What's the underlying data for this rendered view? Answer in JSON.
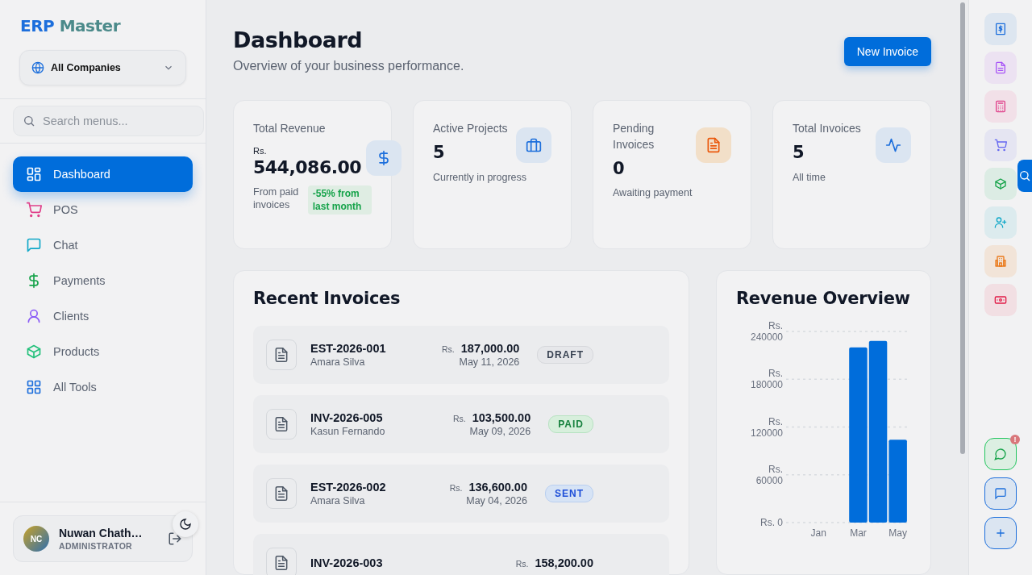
{
  "sidebar": {
    "logo": {
      "first": "ERP",
      "second": "Master"
    },
    "company_select": {
      "value": "All Companies"
    },
    "search": {
      "placeholder": "Search menus..."
    },
    "items": [
      {
        "label": "Dashboard",
        "selected": true
      },
      {
        "label": "POS",
        "selected": false
      },
      {
        "label": "Chat",
        "selected": false
      },
      {
        "label": "Payments",
        "selected": false
      },
      {
        "label": "Clients",
        "selected": false
      },
      {
        "label": "Products",
        "selected": false
      },
      {
        "label": "All Tools",
        "selected": false
      }
    ],
    "user": {
      "initials": "NC",
      "name": "Nuwan Chath…",
      "role": "ADMINISTRATOR"
    }
  },
  "header": {
    "title": "Dashboard",
    "subtitle": "Overview of your business performance.",
    "action": "New Invoice"
  },
  "stats": [
    {
      "title": "Total Revenue",
      "currency": "Rs.",
      "value": "544,086.00",
      "note": "From paid invoices",
      "trend": "-55% from last month"
    },
    {
      "title": "Active Projects",
      "value": "5",
      "note": "Currently in progress"
    },
    {
      "title": "Pending Invoices",
      "value": "0",
      "note": "Awaiting payment"
    },
    {
      "title": "Total Invoices",
      "value": "5",
      "note": "All time"
    }
  ],
  "recent_invoices": {
    "title": "Recent Invoices",
    "rows": [
      {
        "number": "EST-2026-001",
        "client": "Amara Silva",
        "currency": "Rs.",
        "amount": "187,000.00",
        "date": "May 11, 2026",
        "status": {
          "label": "DRAFT",
          "kind": "draft"
        }
      },
      {
        "number": "INV-2026-005",
        "client": "Kasun Fernando",
        "currency": "Rs.",
        "amount": "103,500.00",
        "date": "May 09, 2026",
        "status": {
          "label": "PAID",
          "kind": "paid"
        }
      },
      {
        "number": "EST-2026-002",
        "client": "Amara Silva",
        "currency": "Rs.",
        "amount": "136,600.00",
        "date": "May 04, 2026",
        "status": {
          "label": "SENT",
          "kind": "sent"
        }
      },
      {
        "number": "INV-2026-003",
        "currency": "Rs.",
        "amount": "158,200.00"
      }
    ]
  },
  "revenue_overview": {
    "title": "Revenue Overview",
    "chart_data": {
      "type": "bar",
      "categories": [
        "Jan",
        null,
        "Mar",
        null,
        "May"
      ],
      "values": [
        null,
        null,
        220000,
        228000,
        104000
      ],
      "grid": true,
      "ylim": [
        0,
        240000
      ],
      "yticks": [
        {
          "value": 0,
          "label": "Rs. 0"
        },
        {
          "value": 60000,
          "label": "Rs. 60000"
        },
        {
          "value": 120000,
          "label": "Rs. 120000"
        },
        {
          "value": 180000,
          "label": "Rs. 180000"
        },
        {
          "value": 240000,
          "label": "Rs. 240000"
        }
      ]
    }
  },
  "quick_actions": {
    "chat_badge": "!"
  }
}
